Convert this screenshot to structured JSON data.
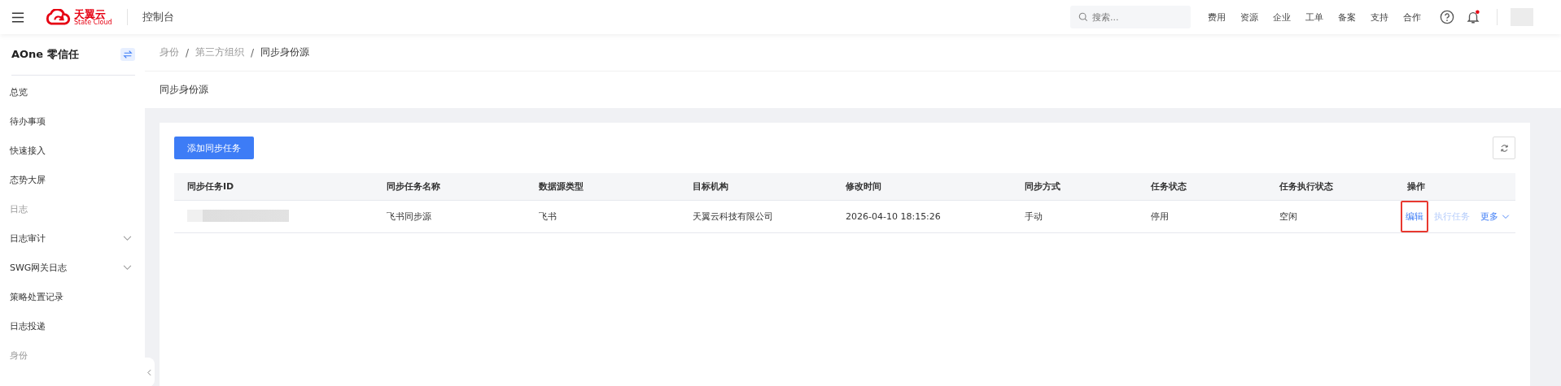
{
  "topbar": {
    "brand": "天翼云",
    "brand_sub": "State Cloud",
    "section": "控制台",
    "search": {
      "placeholder": "搜索..."
    },
    "links": [
      "费用",
      "资源",
      "企业",
      "工单",
      "备案",
      "支持",
      "合作"
    ],
    "notification_dot": true
  },
  "sidebar": {
    "title": "AOne 零信任",
    "items": [
      {
        "label": "总览",
        "kind": "item",
        "expandable": false
      },
      {
        "label": "待办事项",
        "kind": "item",
        "expandable": false
      },
      {
        "label": "快速接入",
        "kind": "item",
        "expandable": false
      },
      {
        "label": "态势大屏",
        "kind": "item",
        "expandable": false
      },
      {
        "label": "日志",
        "kind": "group",
        "expandable": false
      },
      {
        "label": "日志审计",
        "kind": "item",
        "expandable": true
      },
      {
        "label": "SWG网关日志",
        "kind": "item",
        "expandable": true
      },
      {
        "label": "策略处置记录",
        "kind": "item",
        "expandable": false
      },
      {
        "label": "日志投递",
        "kind": "item",
        "expandable": false
      },
      {
        "label": "身份",
        "kind": "group",
        "expandable": false
      }
    ]
  },
  "breadcrumb": {
    "items": [
      "身份",
      "第三方组织",
      "同步身份源"
    ],
    "separator": "/"
  },
  "page_title": "同步身份源",
  "add_button": "添加同步任务",
  "table": {
    "columns": [
      "同步任务ID",
      "同步任务名称",
      "数据源类型",
      "目标机构",
      "修改时间",
      "同步方式",
      "任务状态",
      "任务执行状态",
      "操作"
    ],
    "rows": [
      {
        "id_masked": true,
        "cells": [
          "",
          "飞书同步源",
          "飞书",
          "天翼云科技有限公司",
          "2026-04-10 18:15:26",
          "手动",
          "停用",
          "空闲"
        ],
        "actions": [
          {
            "label": "编辑",
            "kind": "link",
            "disabled": false,
            "highlighted": true
          },
          {
            "label": "执行任务",
            "kind": "link",
            "disabled": true,
            "highlighted": false
          },
          {
            "label": "更多",
            "kind": "dropdown",
            "disabled": false,
            "highlighted": false
          }
        ]
      }
    ]
  }
}
